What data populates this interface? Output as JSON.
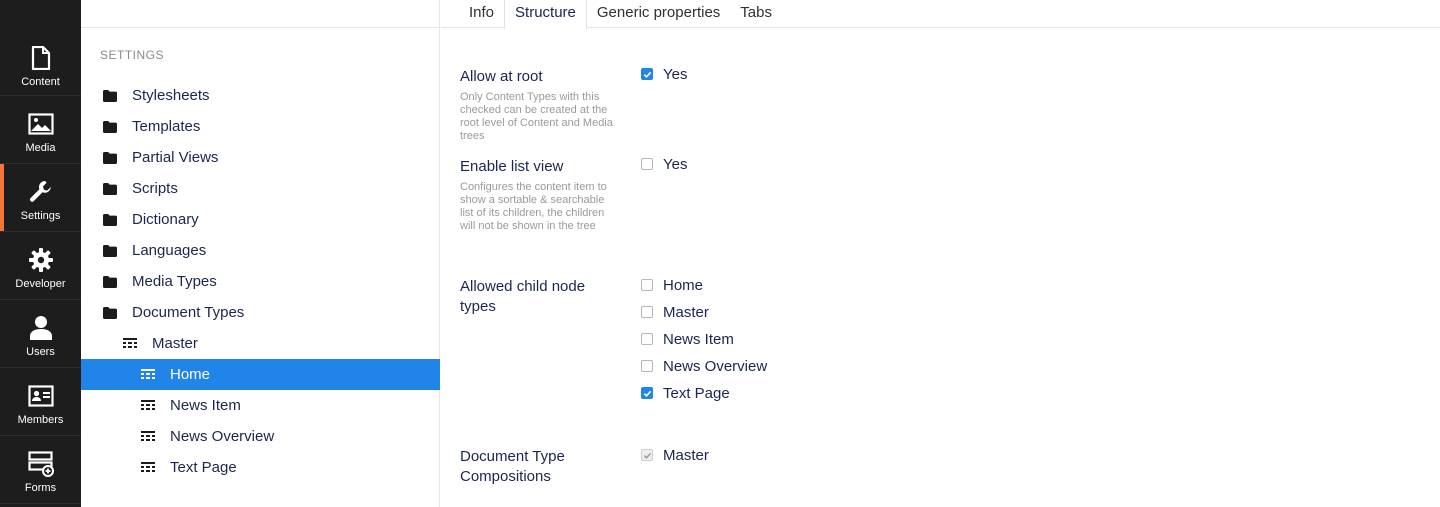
{
  "rail": {
    "items": [
      {
        "label": "Content",
        "icon": "document-icon"
      },
      {
        "label": "Media",
        "icon": "image-icon"
      },
      {
        "label": "Settings",
        "icon": "wrench-icon",
        "active": true
      },
      {
        "label": "Developer",
        "icon": "gear-icon"
      },
      {
        "label": "Users",
        "icon": "user-icon"
      },
      {
        "label": "Members",
        "icon": "id-card-icon"
      },
      {
        "label": "Forms",
        "icon": "forms-icon"
      }
    ]
  },
  "tree": {
    "heading": "Settings",
    "items": [
      {
        "label": "Stylesheets",
        "icon": "folder-icon",
        "level": 0
      },
      {
        "label": "Templates",
        "icon": "folder-icon",
        "level": 0
      },
      {
        "label": "Partial Views",
        "icon": "folder-icon",
        "level": 0
      },
      {
        "label": "Scripts",
        "icon": "folder-icon",
        "level": 0
      },
      {
        "label": "Dictionary",
        "icon": "folder-icon",
        "level": 0
      },
      {
        "label": "Languages",
        "icon": "folder-icon",
        "level": 0
      },
      {
        "label": "Media Types",
        "icon": "folder-icon",
        "level": 0
      },
      {
        "label": "Document Types",
        "icon": "folder-icon",
        "level": 0
      },
      {
        "label": "Master",
        "icon": "doctype-icon",
        "level": 1
      },
      {
        "label": "Home",
        "icon": "doctype-icon",
        "level": 2,
        "selected": true
      },
      {
        "label": "News Item",
        "icon": "doctype-icon",
        "level": 2
      },
      {
        "label": "News Overview",
        "icon": "doctype-icon",
        "level": 2
      },
      {
        "label": "Text Page",
        "icon": "doctype-icon",
        "level": 2
      }
    ]
  },
  "tabs": [
    {
      "label": "Info"
    },
    {
      "label": "Structure",
      "active": true
    },
    {
      "label": "Generic properties"
    },
    {
      "label": "Tabs"
    }
  ],
  "structure": {
    "allow_at_root": {
      "label": "Allow at root",
      "description": "Only Content Types with this checked can be created at the root level of Content and Media trees",
      "option": "Yes",
      "checked": true
    },
    "enable_list_view": {
      "label": "Enable list view",
      "description": "Configures the content item to show a sortable & searchable list of its children, the children will not be shown in the tree",
      "option": "Yes",
      "checked": false
    },
    "allowed_child_node_types": {
      "label": "Allowed child node types",
      "options": [
        {
          "label": "Home",
          "checked": false
        },
        {
          "label": "Master",
          "checked": false
        },
        {
          "label": "News Item",
          "checked": false
        },
        {
          "label": "News Overview",
          "checked": false
        },
        {
          "label": "Text Page",
          "checked": true
        }
      ]
    },
    "compositions": {
      "label": "Document Type Compositions",
      "options": [
        {
          "label": "Master",
          "checked": true,
          "disabled": true
        }
      ]
    }
  },
  "colors": {
    "accent": "#2184e8",
    "active_rail_marker": "#f5743a",
    "rail_bg": "#1d1d1d"
  }
}
